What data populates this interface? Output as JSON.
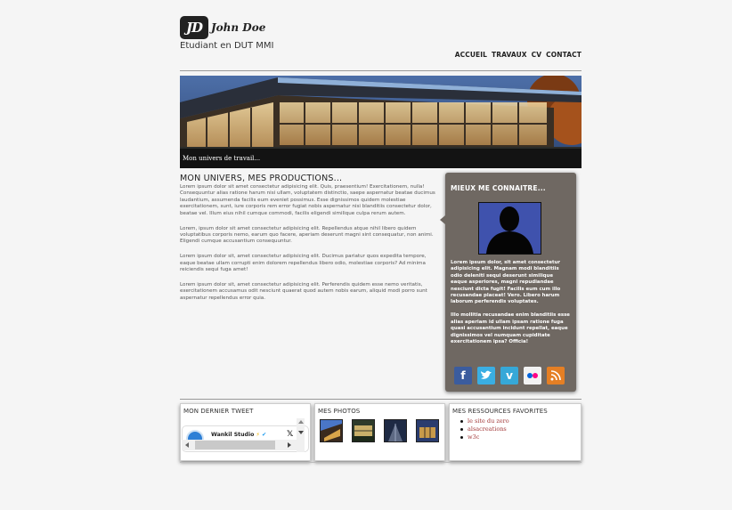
{
  "header": {
    "logo_initials": "JD",
    "name": "John Doe",
    "subtitle": "Etudiant en DUT MMI",
    "nav": [
      "ACCUEIL",
      "TRAVAUX",
      "CV",
      "CONTACT"
    ]
  },
  "banner": {
    "caption": "Mon univers de travail..."
  },
  "main": {
    "title": "MON UNIVERS, MES PRODUCTIONS...",
    "paragraphs": [
      "Lorem ipsum dolor sit amet consectetur adipisicing elit. Quis, praesentium! Exercitationem, nulla! Consequuntur alias ratione harum nisi ullam, voluptatem distinctio, saepe aspernatur beatae ducimus laudantium, assumenda facilis eum eveniet possimus. Esse dignissimos quidem molestiae exercitationem, sunt, iure corporis rem error fugiat nobis aspernatur nisi blanditiis consectetur dolor, beatae vel. Illum eius nihil cumque commodi, facilis eligendi similique culpa rerum autem.",
      "Lorem, ipsum dolor sit amet consectetur adipisicing elit. Repellendus atque nihil libero quidem voluptatibus corporis nemo, earum quo facere, aperiam deserunt magni sint consequatur, non animi. Eligendi cumque accusantium consequuntur.",
      "Lorem ipsum dolor sit, amet consectetur adipisicing elit. Ducimus pariatur quos expedita tempore, eaque beatae ullam corrupti enim dolorem repellendus libero odio, molestiae corporis? Ad minima reiciendis sequi fuga amet!",
      "Lorem ipsum dolor sit, amet consectetur adipisicing elit. Perferendis quidem esse nemo veritatis, exercitationem accusamus odit nesciunt quaerat quod autem nobis earum, aliquid modi porro sunt aspernatur repellendus error quia."
    ]
  },
  "about": {
    "title": "MIEUX ME CONNAITRE...",
    "paragraphs": [
      "Lorem ipsum dolor, sit amet consectetur adipisicing elit. Magnam modi blanditiis odio deleniti sequi deserunt similique eaque asperiores, magni repudiandae nesciunt dicta fugit! Facilis eum cum illo recusandae placeat! Vero. Libero harum laborum perferendis voluptates.",
      "Illo mollitia recusandae enim blanditiis esse alias aperiam id ullam ipsam ratione fuga quasi accusantium incidunt repellat, eaque dignissimos vel numquam cupiditate exercitationem ipsa? Officia!"
    ],
    "socials": [
      "facebook-icon",
      "twitter-icon",
      "vimeo-icon",
      "flickr-icon",
      "rss-icon"
    ]
  },
  "footer": {
    "tweet_title": "MON DERNIER TWEET",
    "tweet_author": "Wankil Studio",
    "photos_title": "MES PHOTOS",
    "resources_title": "MES RESSOURCES FAVORITES",
    "resources": [
      "le site du zero",
      "alsacreations",
      "w3c"
    ]
  },
  "colors": {
    "card_bg": "#6f6862",
    "link": "#a33a3a",
    "avatar_bg": "#3a4ba0"
  }
}
